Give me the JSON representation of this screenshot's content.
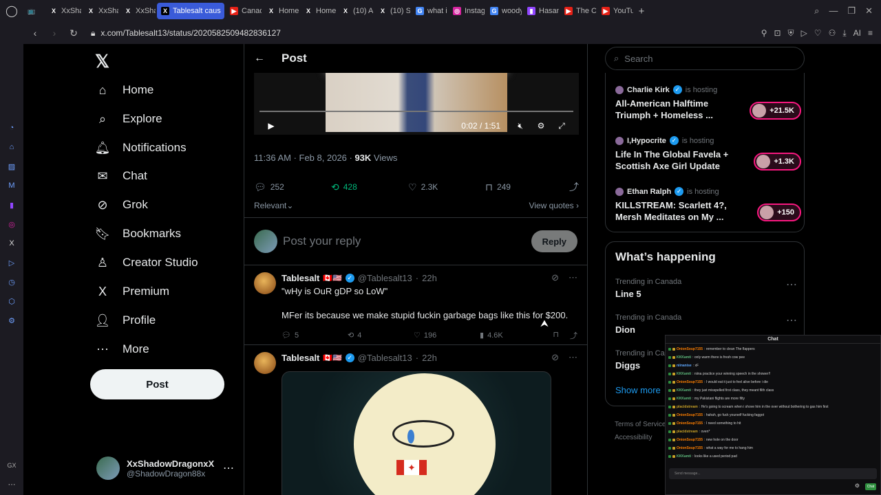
{
  "browser": {
    "tabs": [
      {
        "label": "",
        "fav": "📺",
        "favbg": "#1c1b22"
      },
      {
        "label": "XxShad",
        "fav": "X",
        "favbg": "#1c1b22"
      },
      {
        "label": "XxShad",
        "fav": "X",
        "favbg": "#1c1b22"
      },
      {
        "label": "XxShad",
        "fav": "X",
        "favbg": "#1c1b22"
      },
      {
        "label": "Tablesalt caus",
        "fav": "X",
        "favbg": "#000"
      },
      {
        "label": "Canada",
        "fav": "▶",
        "favbg": "#e62117"
      },
      {
        "label": "Home /",
        "fav": "X",
        "favbg": "#1c1b22"
      },
      {
        "label": "Home /",
        "fav": "X",
        "favbg": "#1c1b22"
      },
      {
        "label": "(10) Alb",
        "fav": "X",
        "favbg": "#1c1b22"
      },
      {
        "label": "(10) Sc",
        "fav": "X",
        "favbg": "#1c1b22"
      },
      {
        "label": "what is",
        "fav": "G",
        "favbg": "#4285f4"
      },
      {
        "label": "Instagr",
        "fav": "◎",
        "favbg": "#d6249f"
      },
      {
        "label": "woody",
        "fav": "G",
        "favbg": "#4285f4"
      },
      {
        "label": "HasanA",
        "fav": "▮",
        "favbg": "#9146ff"
      },
      {
        "label": "The Cu",
        "fav": "▶",
        "favbg": "#e62117"
      },
      {
        "label": "YouTub",
        "fav": "▶",
        "favbg": "#e62117"
      }
    ],
    "url": "x.com/Tablesalt13/status/2020582509482836127",
    "ai_label": "AI"
  },
  "nav": {
    "items": [
      {
        "label": "Home",
        "icon": "⌂",
        "name": "home"
      },
      {
        "label": "Explore",
        "icon": "⌕",
        "name": "explore"
      },
      {
        "label": "Notifications",
        "icon": "🔔︎",
        "name": "notifications"
      },
      {
        "label": "Chat",
        "icon": "✉",
        "name": "chat"
      },
      {
        "label": "Grok",
        "icon": "⊘",
        "name": "grok"
      },
      {
        "label": "Bookmarks",
        "icon": "🔖︎",
        "name": "bookmarks"
      },
      {
        "label": "Creator Studio",
        "icon": "♙",
        "name": "creator-studio"
      },
      {
        "label": "Premium",
        "icon": "X",
        "name": "premium"
      },
      {
        "label": "Profile",
        "icon": "👤︎",
        "name": "profile"
      },
      {
        "label": "More",
        "icon": "⋯",
        "name": "more"
      }
    ],
    "post_label": "Post",
    "account": {
      "name": "XxShadowDragonxX",
      "handle": "@ShadowDragon88x"
    }
  },
  "main": {
    "title": "Post",
    "video": {
      "time": "0:02 / 1:51"
    },
    "meta": {
      "time": "11:36 AM · Feb 8, 2026 · ",
      "views": "93K",
      "views_label": " Views"
    },
    "stats": {
      "replies": "252",
      "reposts": "428",
      "likes": "2.3K",
      "bookmarks": "249"
    },
    "sort_label": "Relevant",
    "view_quotes": "View quotes",
    "reply_placeholder": "Post your reply",
    "reply_button": "Reply",
    "tweets": [
      {
        "name": "Tablesalt",
        "flags": "🇨🇦🇺🇸",
        "handle": "@Tablesalt13",
        "age": "22h",
        "line1": "\"wHy is OuR gDP so LoW\"",
        "line2": "MFer its because we make stupid fuckin garbage bags like this for $200.",
        "replies": "5",
        "reposts": "4",
        "likes": "196",
        "views": "4.6K"
      },
      {
        "name": "Tablesalt",
        "flags": "🇨🇦🇺🇸",
        "handle": "@Tablesalt13",
        "age": "22h"
      }
    ]
  },
  "right": {
    "search_placeholder": "Search",
    "live": [
      {
        "host": "Charlie Kirk",
        "hosting": "is hosting",
        "title": "All-American Halftime Triumph + Homeless ...",
        "count": "+21.5K"
      },
      {
        "host": "I,Hypocrite",
        "hosting": "is hosting",
        "title": "Life In The Global Favela + Scottish Axe Girl Update",
        "count": "+1.3K"
      },
      {
        "host": "Ethan Ralph",
        "hosting": "is hosting",
        "title": "KILLSTREAM: Scarlett 4?, Mersh Meditates on My ...",
        "count": "+150"
      }
    ],
    "happening_title": "What’s happening",
    "trends": [
      {
        "context": "Trending in Canada",
        "name": "Line 5"
      },
      {
        "context": "Trending in Canada",
        "name": "Dion"
      },
      {
        "context": "Trending in Ca",
        "name": "Diggs"
      }
    ],
    "show_more": "Show more",
    "footer": {
      "terms": "Terms of Service",
      "accessibility": "Accessibility"
    }
  },
  "chat": {
    "title": "Chat",
    "messages": [
      {
        "user": "OnionSoup7155",
        "text": ": remember to clean The flappers",
        "color": "#ff7f00"
      },
      {
        "user": "KKKamti",
        "text": ": only warm there is fresh cow pee",
        "color": "#5fba7d"
      },
      {
        "user": "niinanise",
        "text": ": xF",
        "color": "#5fa8ff"
      },
      {
        "user": "KKKamti",
        "text": ": niina practice your winning speech in the shower!!",
        "color": "#5fba7d"
      },
      {
        "user": "OnionSoup7155",
        "text": ": I would eat it just to feel alive before i die",
        "color": "#ff7f00"
      },
      {
        "user": "KKKamti",
        "text": ": they just misspelled first class, they meant filth class",
        "color": "#5fba7d"
      },
      {
        "user": "KKKamti",
        "text": ": my Pakistani flights are more filty",
        "color": "#5fba7d"
      },
      {
        "user": "placidstream",
        "text": ": He's going to scream when i shove him in the over without bothering to gas him first",
        "color": "#c9a227"
      },
      {
        "user": "OnionSoup7155",
        "text": ": hahah, go fuck yourself fucking faggot",
        "color": "#ff7f00"
      },
      {
        "user": "OnionSoup7155",
        "text": ": I need something to hit",
        "color": "#ff7f00"
      },
      {
        "user": "placidstream",
        "text": ": oven*",
        "color": "#c9a227"
      },
      {
        "user": "OnionSoup7155",
        "text": ": new hole on the door",
        "color": "#ff7f00"
      },
      {
        "user": "OnionSoup7155",
        "text": ": what a way for me to hang him",
        "color": "#ff7f00"
      },
      {
        "user": "KKKamti",
        "text": ": looks like a used period pad",
        "color": "#5fba7d"
      }
    ],
    "input_placeholder": "Send message...",
    "send_label": "Chat"
  }
}
